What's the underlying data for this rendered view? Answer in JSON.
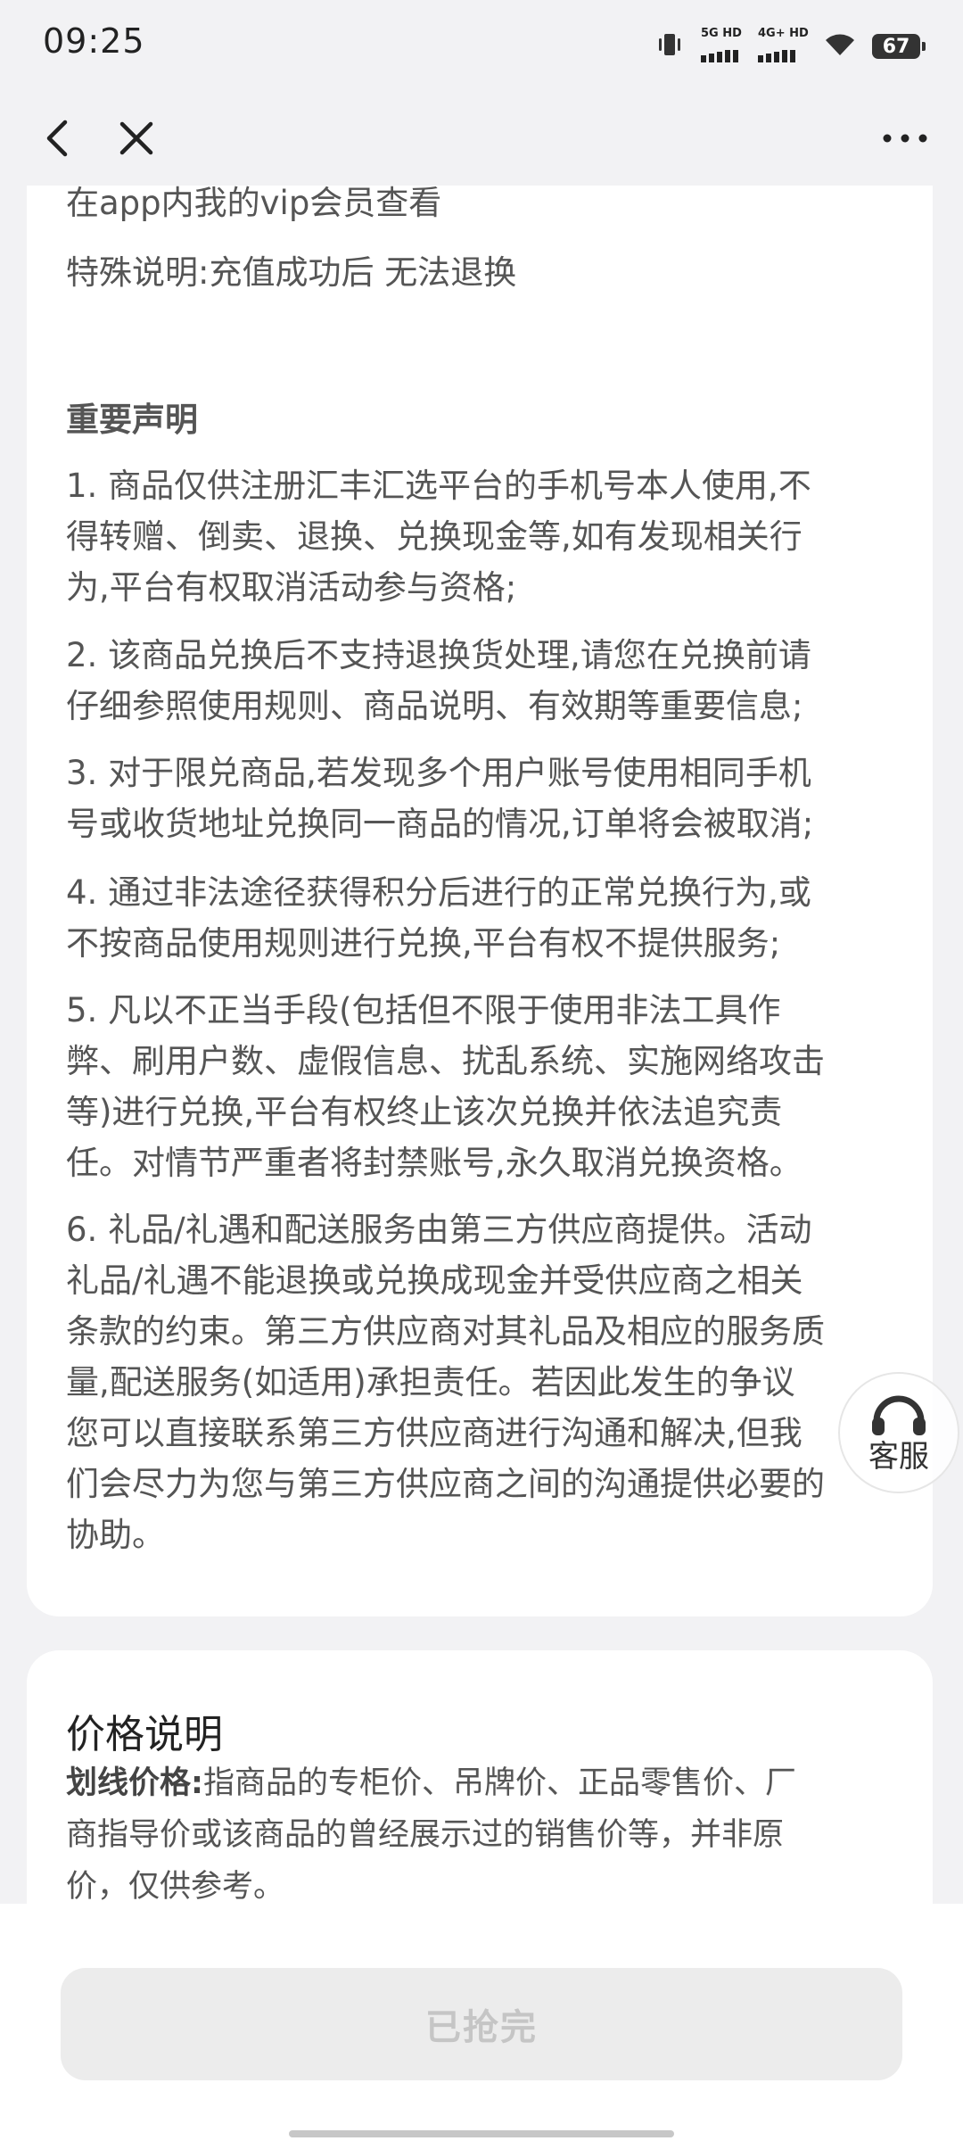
{
  "status_bar": {
    "time": "09:25",
    "signal1_label": "5G HD",
    "signal2_label": "4G+ HD",
    "battery": "67",
    "icons": [
      "vibrate-icon",
      "signal-icon",
      "wifi-icon",
      "battery-icon"
    ]
  },
  "nav": {
    "back_icon": "chevron-left-icon",
    "close_icon": "close-icon",
    "more_icon": "more-dots-icon"
  },
  "content": {
    "line1": "在app内我的vip会员查看",
    "line2": "特殊说明:充值成功后 无法退换",
    "heading": "重要声明",
    "items": [
      [
        "1. 商品仅供注册汇丰汇选平台的手机号本人使用,不",
        "得转赠、倒卖、退换、兑换现金等,如有发现相关行",
        "为,平台有权取消活动参与资格;"
      ],
      [
        "2. 该商品兑换后不支持退换货处理,请您在兑换前请",
        "仔细参照使用规则、商品说明、有效期等重要信息;"
      ],
      [
        "3. 对于限兑商品,若发现多个用户账号使用相同手机",
        "号或收货地址兑换同一商品的情况,订单将会被取消;"
      ],
      [
        "4. 通过非法途径获得积分后进行的正常兑换行为,或",
        "不按商品使用规则进行兑换,平台有权不提供服务;"
      ],
      [
        "5. 凡以不正当手段(包括但不限于使用非法工具作",
        "弊、刷用户数、虚假信息、扰乱系统、实施网络攻击",
        "等)进行兑换,平台有权终止该次兑换并依法追究责",
        "任。对情节严重者将封禁账号,永久取消兑换资格。"
      ],
      [
        "6. 礼品/礼遇和配送服务由第三方供应商提供。活动",
        "礼品/礼遇不能退换或兑换成现金并受供应商之相关",
        "条款的约束。第三方供应商对其礼品及相应的服务质",
        "量,配送服务(如适用)承担责任。若因此发生的争议",
        "您可以直接联系第三方供应商进行沟通和解决,但我",
        "们会尽力为您与第三方供应商之间的沟通提供必要的",
        "协助。"
      ]
    ]
  },
  "price": {
    "title": "价格说明",
    "label": "划线价格:",
    "lines": [
      "指商品的专柜价、吊牌价、正品零售价、厂",
      "商指导价或该商品的曾经展示过的销售价等，并非原",
      "价，仅供参考。"
    ]
  },
  "customer_service": {
    "label": "客服",
    "icon": "headset-icon"
  },
  "bottom": {
    "button_label": "已抢完"
  }
}
